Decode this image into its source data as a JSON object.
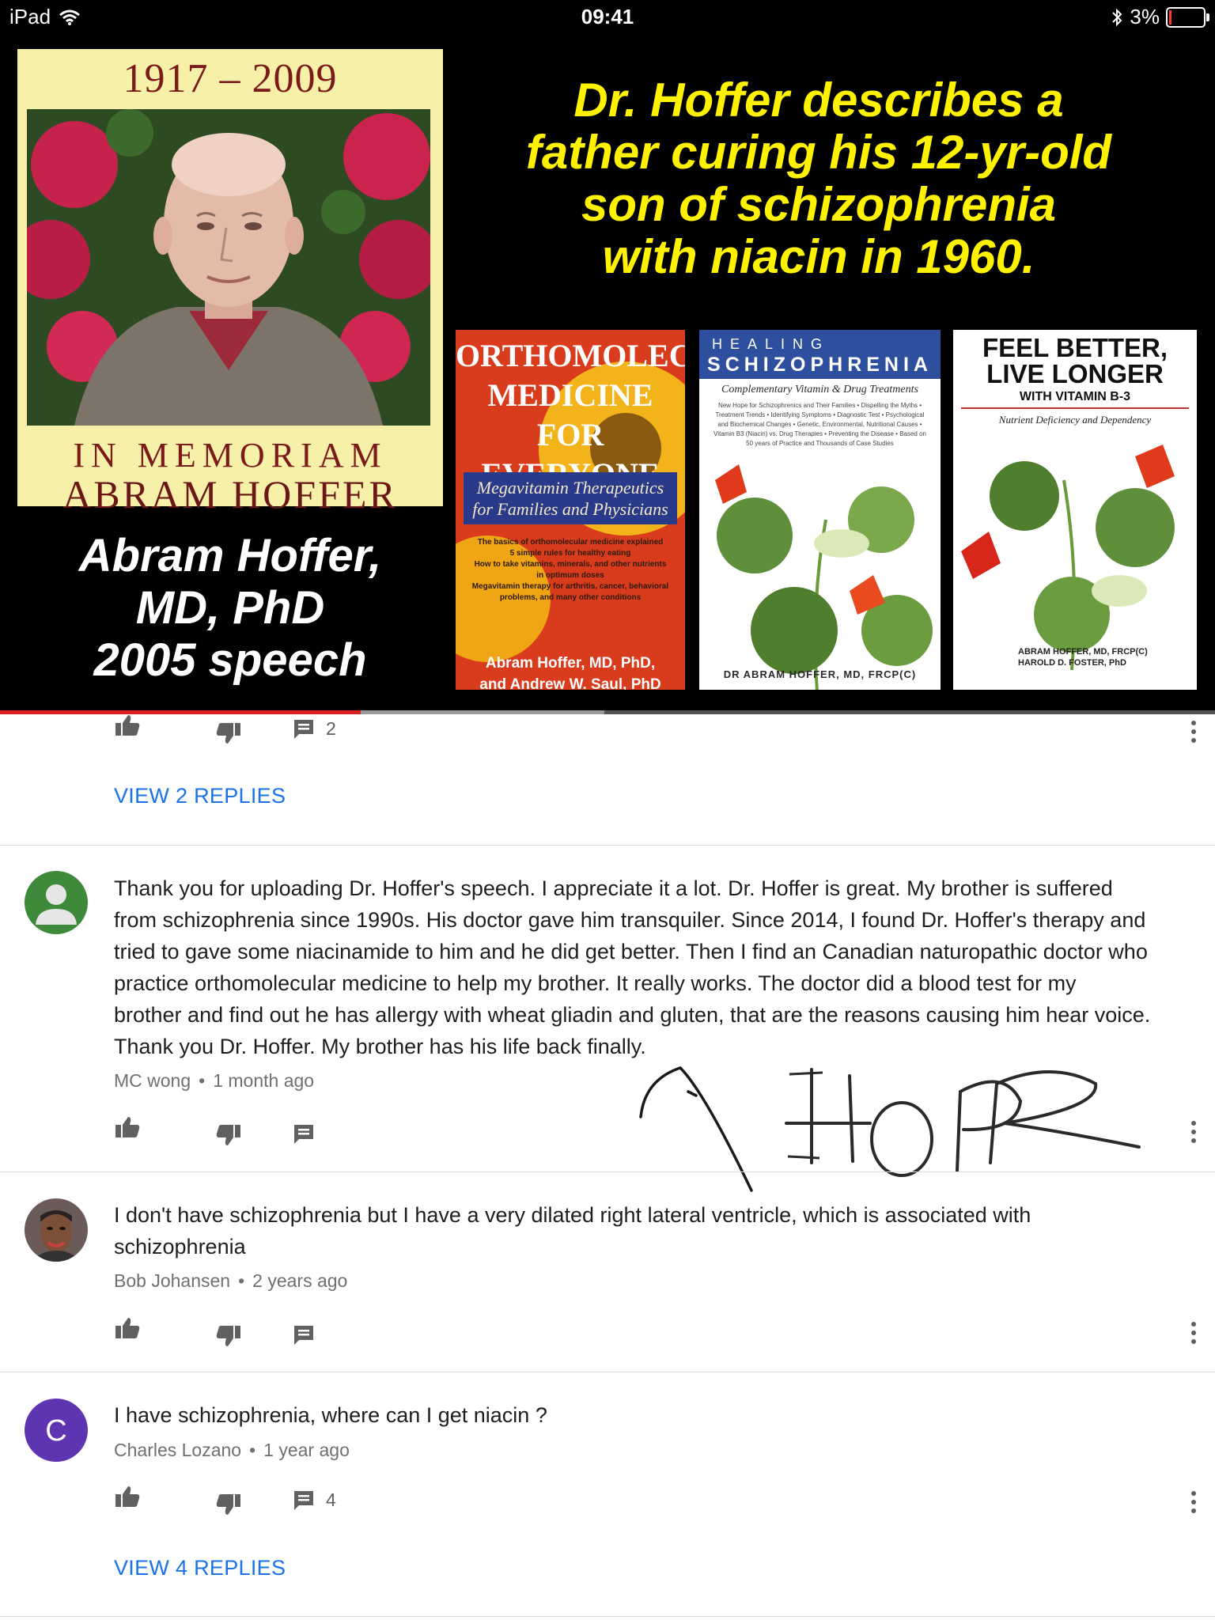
{
  "status_bar": {
    "device": "iPad",
    "time": "09:41",
    "battery": "3%",
    "battery_level": 0.03
  },
  "video": {
    "memorial": {
      "years": "1917 – 2009",
      "line1": "IN MEMORIAM",
      "line2": "ABRAM HOFFER"
    },
    "speaker": [
      "Abram Hoffer,",
      "MD, PhD",
      "2005 speech"
    ],
    "headline": [
      "Dr. Hoffer describes a",
      "father curing his 12-yr-old",
      "son of schizophrenia",
      "with niacin in 1960."
    ],
    "books": [
      {
        "title": [
          "ORTHOMOLECULAR",
          "MEDICINE FOR",
          "EVERYONE"
        ],
        "subtitle": "Megavitamin Therapeutics for Families and Physicians",
        "bullets": [
          "The basics of orthomolecular medicine explained",
          "5 simple rules for healthy eating",
          "How to take vitamins, minerals, and other nutrients in optimum doses",
          "Megavitamin therapy for arthritis, cancer, behavioral problems, and many other conditions"
        ],
        "authors": [
          "Abram Hoffer, MD, PhD,",
          "and Andrew W. Saul, PhD"
        ]
      },
      {
        "kicker": "HEALING",
        "title": "SCHIZOPHRENIA",
        "subtitle": "Complementary Vitamin & Drug Treatments",
        "bullets": "New Hope for Schizophrenics and Their Families • Dispelling the Myths • Treatment Trends • Identifying Symptoms • Diagnostic Test • Psychological and Biochemical Changes • Genetic, Environmental, Nutritional Causes • Vitamin B3 (Niacin) vs. Drug Therapies • Preventing the Disease • Based on 50 years of Practice and Thousands of Case Studies",
        "author": "DR ABRAM HOFFER, MD, FRCP(C)"
      },
      {
        "title": [
          "FEEL BETTER,",
          "LIVE LONGER"
        ],
        "with": "WITH VITAMIN B-3",
        "subtitle": "Nutrient Deficiency and Dependency",
        "authors": [
          "ABRAM HOFFER, MD, FRCP(C)",
          "HAROLD D. FOSTER, PhD"
        ]
      }
    ],
    "progress": 0.297
  },
  "comments": [
    {
      "partial": true,
      "reply_count": "2",
      "view_replies": "VIEW 2 REPLIES"
    },
    {
      "author": "MC wong",
      "age": "1 month ago",
      "avatar_color": "#3f8a3a",
      "lines": [
        "Thank you for uploading Dr. Hoffer's speech. I appreciate it a lot. Dr. Hoffer is great. My brother is suffered",
        "from schizophrenia since 1990s. His doctor gave him transquiler. Since 2014, I found Dr. Hoffer's therapy and",
        "tried to gave some niacinamide to him and he did get better. Then I find an Canadian naturopathic doctor who",
        "practice orthomolecular medicine to help my brother. It really works. The doctor did a blood test for my",
        "brother and find out he has allergy with wheat gliadin and gluten, that are the reasons causing him hear voice.",
        "Thank you Dr. Hoffer. My brother has his life back finally."
      ]
    },
    {
      "author": "Bob Johansen",
      "age": "2 years ago",
      "lines": [
        "I don't have schizophrenia but I have a very dilated right lateral ventricle, which is associated with",
        "schizophrenia"
      ]
    },
    {
      "author": "Charles Lozano",
      "age": "1 year ago",
      "avatar_letter": "C",
      "avatar_color": "#5e35b1",
      "lines": [
        "I have schizophrenia, where can I get niacin ?"
      ],
      "reply_count": "4",
      "view_replies": "VIEW 4 REPLIES"
    }
  ],
  "annotation": "HOPE",
  "colors": {
    "accent": "#1a73e8",
    "headline_yellow": "#fff200",
    "progress_red": "#e02020"
  }
}
